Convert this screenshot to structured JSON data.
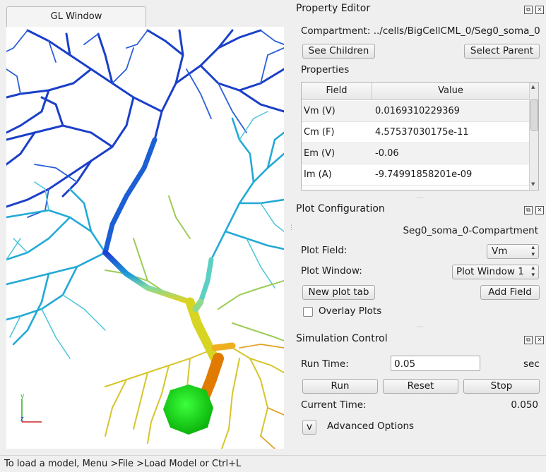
{
  "gl_window": {
    "tab_label": "GL Window"
  },
  "axes": {
    "y_label": "y",
    "z_label": "z"
  },
  "colors": {
    "dendrite_top": "#0a3fc8",
    "dendrite_mid": "#2fb7d6",
    "dendrite_low": "#d9c92a",
    "soma": "#15e015",
    "axon": "#e07b00"
  },
  "property_editor": {
    "title": "Property Editor",
    "compartment_label": "Compartment:",
    "compartment_path": "../cells/BigCellCML_0/Seg0_soma_0",
    "see_children": "See  Children",
    "select_parent": "Select Parent",
    "properties_label": "Properties",
    "columns": [
      "Field",
      "Value"
    ],
    "rows": [
      {
        "field": "Vm (V)",
        "value": "0.0169310229369"
      },
      {
        "field": "Cm (F)",
        "value": "4.57537030175e-11"
      },
      {
        "field": "Em (V)",
        "value": "-0.06"
      },
      {
        "field": "Im (A)",
        "value": "-9.74991858201e-09"
      }
    ]
  },
  "plot_config": {
    "title": "Plot Configuration",
    "target": "Seg0_soma_0-Compartment",
    "plot_field_label": "Plot Field:",
    "plot_field_value": "Vm",
    "plot_window_label": "Plot Window:",
    "plot_window_value": "Plot Window 1",
    "new_plot_tab": "New plot tab",
    "add_field": "Add Field",
    "overlay_label": "Overlay Plots",
    "overlay_checked": false
  },
  "sim_control": {
    "title": "Simulation Control",
    "run_time_label": "Run Time:",
    "run_time_value": "0.05",
    "run_time_unit": "sec",
    "run": "Run",
    "reset": "Reset",
    "stop": "Stop",
    "current_time_label": "Current Time:",
    "current_time_value": "0.050",
    "advanced_toggle": "v",
    "advanced_label": "Advanced Options"
  },
  "status_bar": {
    "text": "To load a model, Menu >File >Load Model or Ctrl+L"
  }
}
